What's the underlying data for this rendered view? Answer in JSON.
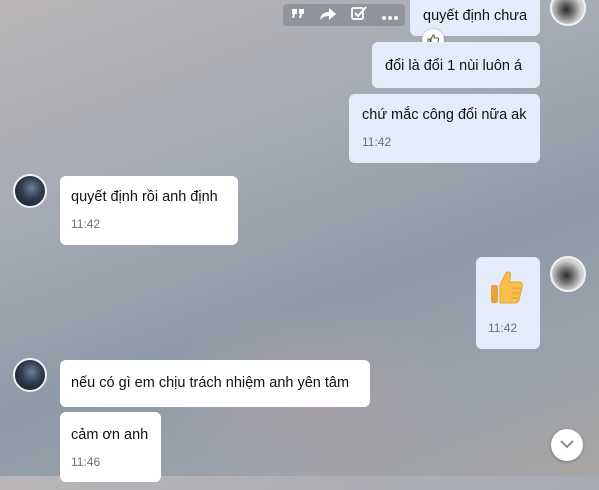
{
  "toolbar": {
    "quote_icon": "quote-icon",
    "forward_icon": "forward-icon",
    "task_icon": "task-check-icon",
    "more_icon": "more-icon"
  },
  "messages": [
    {
      "sender": "me",
      "text": "quyết định chưa",
      "time": ""
    },
    {
      "sender": "me",
      "text": "đổi là đổi 1 nùi luôn á",
      "time": "",
      "reaction_icon": "thumbs-up-icon"
    },
    {
      "sender": "me",
      "text": "chứ mắc công đổi nữa ak",
      "time": "11:42"
    },
    {
      "sender": "other",
      "text": "quyết định rồi anh định",
      "time": "11:42"
    },
    {
      "sender": "me",
      "sticker": "thumbs-up-emoji",
      "time": "11:42"
    },
    {
      "sender": "other",
      "text": "nếu có gì em chịu trách nhiệm anh yên tâm",
      "time": ""
    },
    {
      "sender": "other",
      "text": "cảm ơn anh",
      "time": "11:46"
    }
  ],
  "colors": {
    "my_bubble": "#e4ecfb",
    "their_bubble": "#ffffff",
    "timestamp": "#6b6f75"
  },
  "scroll_icon": "chevron-down-icon"
}
